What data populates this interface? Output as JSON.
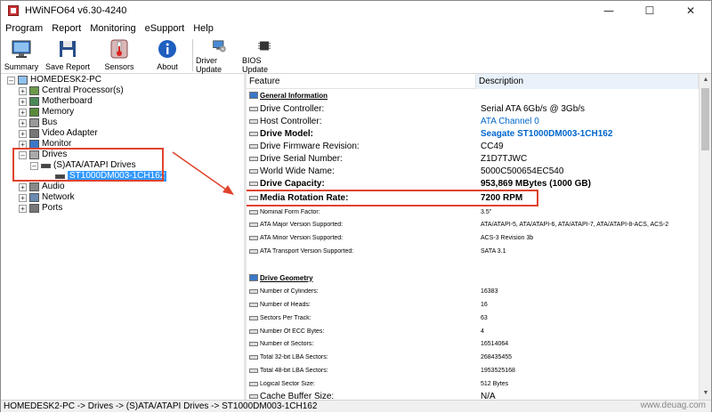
{
  "window": {
    "title": "HWiNFO64 v6.30-4240"
  },
  "menu": [
    "Program",
    "Report",
    "Monitoring",
    "eSupport",
    "Help"
  ],
  "toolbar": {
    "buttons": [
      {
        "label": "Summary",
        "icon": "monitor-icon"
      },
      {
        "label": "Save Report",
        "icon": "floppy-disk-icon"
      },
      {
        "label": "Sensors",
        "icon": "thermometer-icon"
      },
      {
        "label": "About",
        "icon": "info-icon"
      },
      {
        "label": "Driver Update",
        "icon": "driver-update-icon"
      },
      {
        "label": "BIOS Update",
        "icon": "chip-icon"
      }
    ]
  },
  "tree": {
    "root": "HOMEDESK2-PC",
    "items": [
      "Central Processor(s)",
      "Motherboard",
      "Memory",
      "Bus",
      "Video Adapter",
      "Monitor",
      "Drives",
      "(S)ATA/ATAPI Drives",
      "ST1000DM003-1CH162",
      "Audio",
      "Network",
      "Ports"
    ]
  },
  "grid": {
    "headers": [
      "Feature",
      "Description"
    ],
    "rows": [
      {
        "feature": "General Information",
        "value": "",
        "style": "section"
      },
      {
        "feature": "Drive Controller:",
        "value": "Serial ATA 6Gb/s @ 3Gb/s",
        "style": "normal"
      },
      {
        "feature": "Host Controller:",
        "value": "ATA Channel 0",
        "style": "link"
      },
      {
        "feature": "Drive Model:",
        "value": "Seagate ST1000DM003-1CH162",
        "style": "boldlink"
      },
      {
        "feature": "Drive Firmware Revision:",
        "value": "CC49",
        "style": "normal"
      },
      {
        "feature": "Drive Serial Number:",
        "value": "Z1D7TJWC",
        "style": "normal"
      },
      {
        "feature": "World Wide Name:",
        "value": "5000C500654EC540",
        "style": "normal"
      },
      {
        "feature": "Drive Capacity:",
        "value": "953,869 MBytes (1000 GB)",
        "style": "bold"
      },
      {
        "feature": "Media Rotation Rate:",
        "value": "7200 RPM",
        "style": "bold"
      },
      {
        "feature": "Nominal Form Factor:",
        "value": "3.5\"",
        "style": "small"
      },
      {
        "feature": "ATA Major Version Supported:",
        "value": "ATA/ATAPI-5, ATA/ATAPI-6, ATA/ATAPI-7, ATA/ATAPI-8-ACS, ACS-2",
        "style": "small"
      },
      {
        "feature": "ATA Minor Version Supported:",
        "value": "ACS-3 Revision 3b",
        "style": "small"
      },
      {
        "feature": "ATA Transport Version Supported:",
        "value": "SATA 3.1",
        "style": "small"
      },
      {
        "feature": "",
        "value": "",
        "style": "blank"
      },
      {
        "feature": "Drive Geometry",
        "value": "",
        "style": "section"
      },
      {
        "feature": "Number of Cylinders:",
        "value": "16383",
        "style": "small"
      },
      {
        "feature": "Number of Heads:",
        "value": "16",
        "style": "small"
      },
      {
        "feature": "Sectors Per Track:",
        "value": "63",
        "style": "small"
      },
      {
        "feature": "Number Of ECC Bytes:",
        "value": "4",
        "style": "small"
      },
      {
        "feature": "Number of Sectors:",
        "value": "16514064",
        "style": "small"
      },
      {
        "feature": "Total 32-bit LBA Sectors:",
        "value": "268435455",
        "style": "small"
      },
      {
        "feature": "Total 48-bit LBA Sectors:",
        "value": "1953525168",
        "style": "small"
      },
      {
        "feature": "Logical Sector Size:",
        "value": "512 Bytes",
        "style": "small"
      },
      {
        "feature": "Cache Buffer Size:",
        "value": "N/A",
        "style": "medium"
      }
    ]
  },
  "status_bar": "HOMEDESK2-PC -> Drives -> (S)ATA/ATAPI Drives -> ST1000DM003-1CH162",
  "watermark": "www.deuag.com",
  "colors": {
    "annotation": "#e0432c",
    "selection": "#3399ff",
    "link": "#0066cc"
  }
}
